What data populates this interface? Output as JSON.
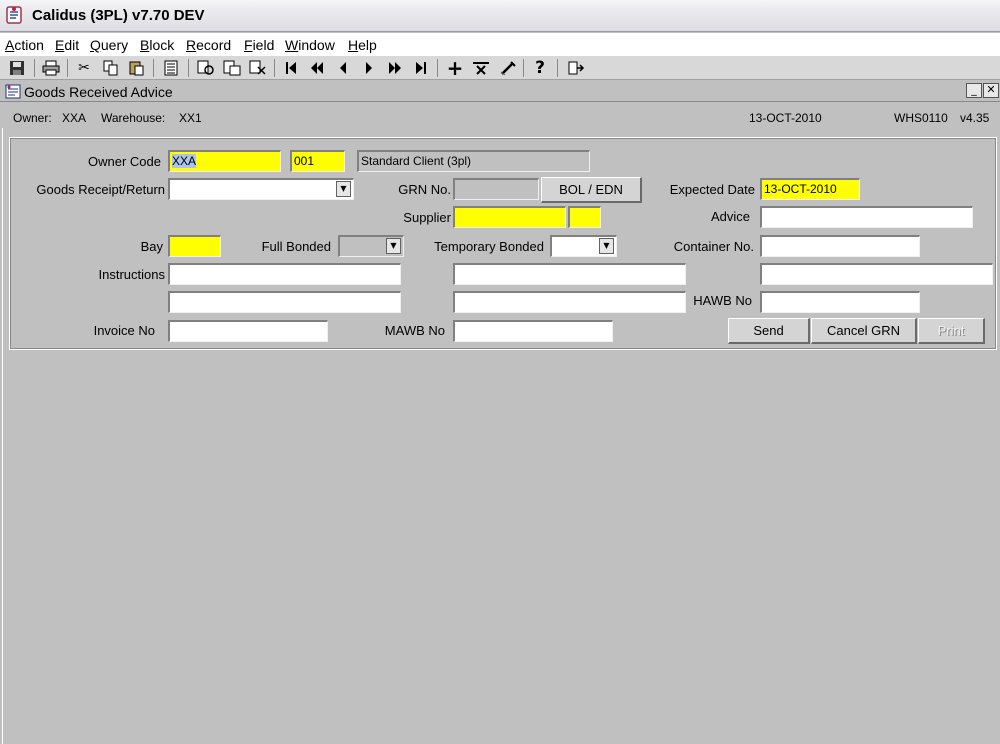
{
  "window": {
    "title": "Calidus (3PL) v7.70 DEV"
  },
  "menu": [
    {
      "label": "Action",
      "key": "A"
    },
    {
      "label": "Edit",
      "key": "E"
    },
    {
      "label": "Query",
      "key": "Q"
    },
    {
      "label": "Block",
      "key": "B"
    },
    {
      "label": "Record",
      "key": "R"
    },
    {
      "label": "Field",
      "key": "F"
    },
    {
      "label": "Window",
      "key": "W"
    },
    {
      "label": "Help",
      "key": "H"
    }
  ],
  "toolbar": {
    "icons": [
      "save-icon",
      "print-icon",
      "cut-icon",
      "copy-icon",
      "paste-icon",
      "list-icon",
      "enter-query-icon",
      "execute-query-icon",
      "cancel-query-icon",
      "first-record-icon",
      "previous-block-icon",
      "previous-record-icon",
      "next-record-icon",
      "next-block-icon",
      "last-record-icon",
      "insert-record-icon",
      "delete-record-icon",
      "clear-record-icon",
      "help-icon",
      "exit-icon"
    ]
  },
  "document": {
    "title": "Goods Received Advice"
  },
  "info": {
    "owner_label": "Owner:",
    "owner_value": "XXA",
    "warehouse_label": "Warehouse:",
    "warehouse_value": "XX1",
    "date": "13-OCT-2010",
    "module": "WHS0110",
    "version": "v4.35"
  },
  "form": {
    "owner_code_label": "Owner Code",
    "owner_code_value": "XXA",
    "owner_suffix_value": "001",
    "owner_name_value": "Standard Client (3pl)",
    "goods_receipt_label": "Goods Receipt/Return",
    "goods_receipt_value": "",
    "grn_no_label": "GRN No.",
    "grn_no_value": "",
    "bol_edn_button": "BOL / EDN",
    "expected_date_label": "Expected Date",
    "expected_date_value": "13-OCT-2010",
    "supplier_label": "Supplier",
    "supplier_value": "",
    "supplier_code_value": "",
    "advice_label": "Advice",
    "advice_value": "",
    "bay_label": "Bay",
    "bay_value": "",
    "full_bonded_label": "Full Bonded",
    "full_bonded_value": "",
    "temporary_bonded_label": "Temporary Bonded",
    "temporary_bonded_value": "",
    "container_no_label": "Container No.",
    "container_no_value": "",
    "instructions_label": "Instructions",
    "instructions_1": "",
    "instructions_2": "",
    "instructions_3": "",
    "instructions_4": "",
    "instructions_5": "",
    "hawb_no_label": "HAWB No",
    "hawb_no_value": "",
    "invoice_no_label": "Invoice No",
    "invoice_no_value": "",
    "mawb_no_label": "MAWB No",
    "mawb_no_value": "",
    "send_button": "Send",
    "cancel_grn_button": "Cancel GRN",
    "print_button": "Print"
  },
  "colors": {
    "background": "#c0c0c0",
    "mandatory_field": "#ffff00",
    "field": "#ffffff"
  }
}
